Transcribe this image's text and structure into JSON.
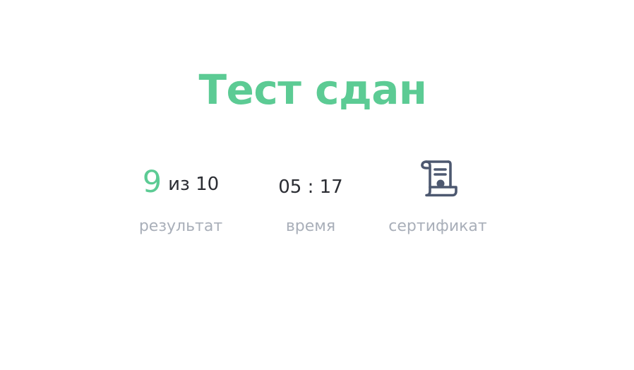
{
  "title": "Тест сдан",
  "result": {
    "score": "9",
    "score_total": "из 10",
    "label": "результат"
  },
  "time": {
    "value": "05 : 17",
    "label": "время"
  },
  "certificate": {
    "icon": "certificate-scroll-icon",
    "label": "сертификат"
  },
  "colors": {
    "accent": "#5ccb94",
    "text": "#2b2d33",
    "muted": "#a9afb9",
    "icon": "#4d5870"
  }
}
